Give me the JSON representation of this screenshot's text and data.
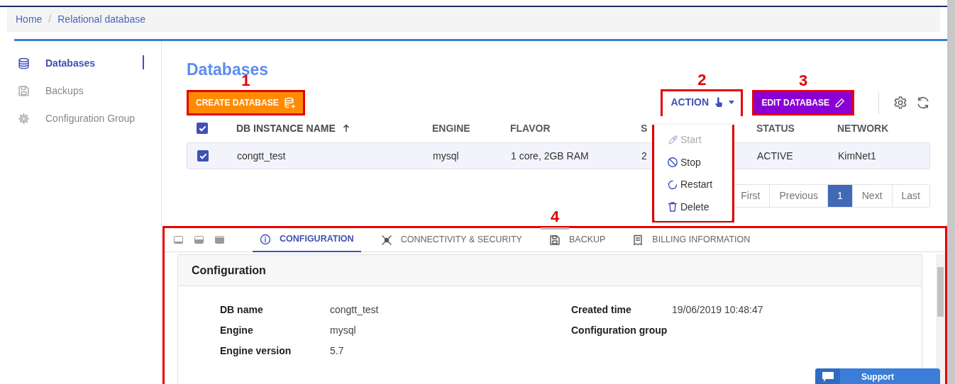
{
  "breadcrumb": [
    {
      "label": "Home"
    },
    {
      "label": "Relational database"
    }
  ],
  "breadcrumb_separator": "/",
  "sidebar": {
    "items": [
      {
        "label": "Databases",
        "selected": true
      },
      {
        "label": "Backups",
        "selected": false
      },
      {
        "label": "Configuration Group",
        "selected": false
      }
    ]
  },
  "page_title": "Databases",
  "create_button": {
    "label": "CREATE DATABASE",
    "annotation": "1"
  },
  "action_button": {
    "label": "ACTION",
    "annotation": "2"
  },
  "edit_button": {
    "label": "EDIT DATABASE",
    "annotation": "3"
  },
  "action_menu": [
    {
      "label": "Start",
      "disabled": true
    },
    {
      "label": "Stop",
      "disabled": false
    },
    {
      "label": "Restart",
      "disabled": false
    },
    {
      "label": "Delete",
      "disabled": false
    }
  ],
  "table": {
    "select_all_checked": true,
    "columns": [
      {
        "label": "DB INSTANCE NAME",
        "sorted": true
      },
      {
        "label": "ENGINE",
        "sorted": false
      },
      {
        "label": "FLAVOR",
        "sorted": false
      },
      {
        "label": "S",
        "sorted": false
      },
      {
        "label": "STATUS",
        "sorted": false
      },
      {
        "label": "NETWORK",
        "sorted": false
      }
    ],
    "rows": [
      {
        "selected": true,
        "cells": [
          "congtt_test",
          "mysql",
          "1 core, 2GB RAM",
          "2",
          "ACTIVE",
          "KimNet1"
        ]
      }
    ]
  },
  "pagination": [
    {
      "label": "First",
      "selected": false
    },
    {
      "label": "Previous",
      "selected": false
    },
    {
      "label": "1",
      "selected": true
    },
    {
      "label": "Next",
      "selected": false
    },
    {
      "label": "Last",
      "selected": false
    }
  ],
  "detail_panel": {
    "annotation": "4",
    "tabs": [
      {
        "label": "CONFIGURATION",
        "selected": true
      },
      {
        "label": "CONNECTIVITY & SECURITY",
        "selected": false
      },
      {
        "label": "BACKUP",
        "selected": false
      },
      {
        "label": "BILLING INFORMATION",
        "selected": false
      }
    ],
    "card_title": "Configuration",
    "fields_left": [
      {
        "label": "DB name",
        "value": "congtt_test"
      },
      {
        "label": "Engine",
        "value": "mysql"
      },
      {
        "label": "Engine version",
        "value": "5.7"
      }
    ],
    "fields_right": [
      {
        "label": "Created time",
        "value": "19/06/2019 10:48:47"
      },
      {
        "label": "Configuration group"
      }
    ]
  },
  "support_button": {
    "label": "Support"
  }
}
